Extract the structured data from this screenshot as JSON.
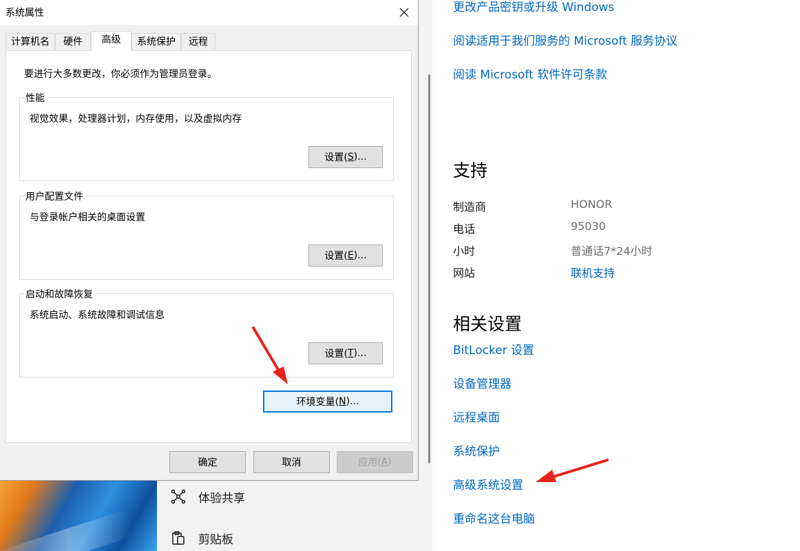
{
  "dialog": {
    "title": "系统属性",
    "tabs": [
      "计算机名",
      "硬件",
      "高级",
      "系统保护",
      "远程"
    ],
    "active_tab": "高级",
    "admin_note": "要进行大多数更改，你必须作为管理员登录。",
    "groups": [
      {
        "title": "性能",
        "desc": "视觉效果，处理器计划，内存使用，以及虚拟内存",
        "button_pre": "设置(",
        "button_key": "S",
        "button_post": ")..."
      },
      {
        "title": "用户配置文件",
        "desc": "与登录帐户相关的桌面设置",
        "button_pre": "设置(",
        "button_key": "E",
        "button_post": ")..."
      },
      {
        "title": "启动和故障恢复",
        "desc": "系统启动、系统故障和调试信息",
        "button_pre": "设置(",
        "button_key": "T",
        "button_post": ")..."
      }
    ],
    "env_button": {
      "pre": "环境变量(",
      "key": "N",
      "post": ")..."
    },
    "ok": "确定",
    "cancel": "取消",
    "apply": {
      "pre": "应用(",
      "key": "A",
      "post": ")"
    }
  },
  "settings": {
    "top_links": [
      "更改产品密钥或升级 Windows",
      "阅读适用于我们服务的 Microsoft 服务协议",
      "阅读 Microsoft 软件许可条款"
    ],
    "support": {
      "heading": "支持",
      "rows": [
        {
          "key": "制造商",
          "value": "HONOR"
        },
        {
          "key": "电话",
          "value": "95030"
        },
        {
          "key": "小时",
          "value": "普通话7*24小时"
        },
        {
          "key": "网站",
          "value": "联机支持"
        }
      ]
    },
    "related": {
      "heading": "相关设置",
      "links": [
        "BitLocker 设置",
        "设备管理器",
        "远程桌面",
        "系统保护",
        "高级系统设置",
        "重命名这台电脑"
      ]
    }
  },
  "background_menu": {
    "items": [
      {
        "label": "体验共享",
        "icon": "share-network-icon"
      },
      {
        "label": "剪贴板",
        "icon": "clipboard-icon"
      }
    ]
  },
  "colors": {
    "link": "#0067c0",
    "annotation": "#e8231b",
    "primary_border": "#0078d7"
  }
}
